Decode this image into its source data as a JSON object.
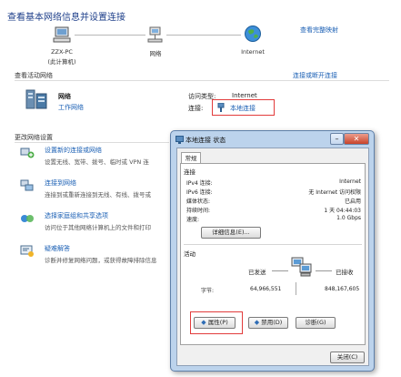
{
  "header": {
    "title": "查看基本网络信息并设置连接",
    "full_map_link": "查看完整映射"
  },
  "network_map": {
    "computer": {
      "name": "ZZX-PC",
      "sub": "(此计算机)",
      "icon": "computer-icon"
    },
    "network": {
      "name": "网络",
      "icon": "network-icon"
    },
    "internet": {
      "name": "Internet",
      "icon": "globe-icon"
    }
  },
  "active_networks": {
    "label": "查看活动网络",
    "connect_link": "连接或断开连接",
    "network_name": "网络",
    "network_type": "工作网络",
    "access_type_label": "访问类型:",
    "access_type_value": "Internet",
    "connections_label": "连接:",
    "connection_name": "本地连接"
  },
  "settings": {
    "label": "更改网络设置",
    "items": [
      {
        "title": "设置新的连接或网络",
        "desc": "设置无线、宽带、拨号、临时或 VPN 连",
        "icon": "new-connection-icon"
      },
      {
        "title": "连接到网络",
        "desc": "连接到或重新连接到无线、有线、拨号或",
        "icon": "connect-network-icon"
      },
      {
        "title": "选择家庭组和共享选项",
        "desc": "访问位于其他网络计算机上的文件和打印",
        "icon": "homegroup-icon"
      },
      {
        "title": "疑难解答",
        "desc": "诊断并修复网络问题，或获得故障排除信息",
        "icon": "troubleshoot-icon"
      }
    ]
  },
  "dialog": {
    "title": "本地连接 状态",
    "tab": "常规",
    "connection_group": "连接",
    "rows": [
      {
        "label": "IPv4 连接:",
        "value": "Internet"
      },
      {
        "label": "IPv6 连接:",
        "value": "无 Internet 访问权限"
      },
      {
        "label": "媒体状态:",
        "value": "已启用"
      },
      {
        "label": "持续时间:",
        "value": "1 天 04:44:03"
      },
      {
        "label": "速度:",
        "value": "1.0 Gbps"
      }
    ],
    "details_button": "详细信息(E)...",
    "activity_group": "活动",
    "sent_label": "已发送",
    "received_label": "已接收",
    "bytes_label": "字节:",
    "bytes_sent": "64,966,551",
    "bytes_received": "848,167,605",
    "properties_button": "属性(P)",
    "disable_button": "禁用(D)",
    "diagnose_button": "诊断(G)",
    "close_button": "关闭(C)"
  }
}
